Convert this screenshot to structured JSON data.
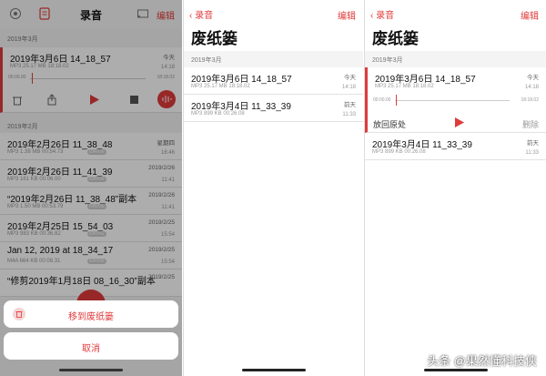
{
  "accent": "#e03b3b",
  "panel1": {
    "title": "录音",
    "edit": "编辑",
    "section_march": "2019年3月",
    "section_feb": "2019年2月",
    "selected": {
      "title": "2019年3月6日 14_18_57",
      "meta": "MP3   25.17 MB   18:18.02",
      "date": "今天",
      "time": "14:18",
      "elapsed": "00:00.00",
      "remaining": "18:18.02"
    },
    "rows": [
      {
        "title": "2019年2月26日 11_38_48",
        "meta": "MP3   1.38 MB   00:54.73",
        "date": "星期四",
        "time": "16:46",
        "badge": "IDRIVE"
      },
      {
        "title": "2019年2月26日 11_41_39",
        "meta": "MP3   161 KB   00:06.00",
        "date": "2019/2/26",
        "time": "11:41",
        "badge": "IDRIVE"
      },
      {
        "title": "“2019年2月26日 11_38_48”副本",
        "meta": "MP3   1.50 MB   00:53.79",
        "date": "2019/2/26",
        "time": "11:41",
        "badge": "IDRIVE"
      },
      {
        "title": "2019年2月25日 15_54_03",
        "meta": "MP3   983 KB   00:36.82",
        "date": "2019/2/25",
        "time": "15:54",
        "badge": "IDRIVE"
      },
      {
        "title": "Jan 12, 2019 at 18_34_17",
        "meta": "M4A   664 KB   00:08.31",
        "date": "2019/2/25",
        "time": "15:54",
        "badge": "IDRIVE"
      },
      {
        "title": "“修剪2019年1月18日 08_16_30”副本",
        "meta": "",
        "date": "2019/2/25",
        "time": "",
        "badge": ""
      }
    ],
    "action_sheet": {
      "move": "移到废纸篓",
      "cancel": "取消"
    }
  },
  "panel2": {
    "back": "录音",
    "edit": "编辑",
    "title": "废纸篓",
    "section": "2019年3月",
    "rows": [
      {
        "title": "2019年3月6日 14_18_57",
        "meta": "MP3   25.17 MB   18:18.02",
        "date": "今天",
        "time": "14:18"
      },
      {
        "title": "2019年3月4日 11_33_39",
        "meta": "MP3   899 KB   00:26.08",
        "date": "前天",
        "time": "11:33"
      }
    ]
  },
  "panel3": {
    "back": "录音",
    "edit": "编辑",
    "title": "废纸篓",
    "section": "2019年3月",
    "selected": {
      "title": "2019年3月6日 14_18_57",
      "meta": "MP3   25.17 MB   18:18.02",
      "date": "今天",
      "time": "14:18",
      "elapsed": "00:00.00",
      "remaining": "18:18.02",
      "restore": "放回原处",
      "delete": "删除"
    },
    "row": {
      "title": "2019年3月4日 11_33_39",
      "meta": "MP3   899 KB   00:26.08",
      "date": "前天",
      "time": "11:33"
    }
  },
  "watermark": "头条 @果然懂科技侠"
}
